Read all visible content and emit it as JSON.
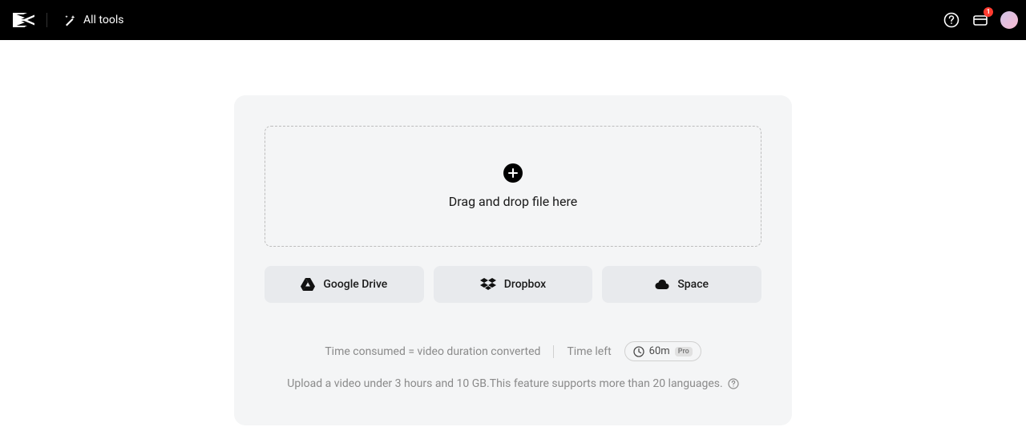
{
  "header": {
    "all_tools_label": "All tools",
    "notification_badge": "1"
  },
  "dropzone": {
    "text": "Drag and drop file here"
  },
  "sources": {
    "google_drive": "Google Drive",
    "dropbox": "Dropbox",
    "space": "Space"
  },
  "info": {
    "time_consumed": "Time consumed = video duration converted",
    "time_left_label": "Time left",
    "time_value": "60m",
    "pro_label": "Pro"
  },
  "hint": {
    "text": "Upload a video under 3 hours and 10 GB.This feature supports more than 20 languages."
  }
}
